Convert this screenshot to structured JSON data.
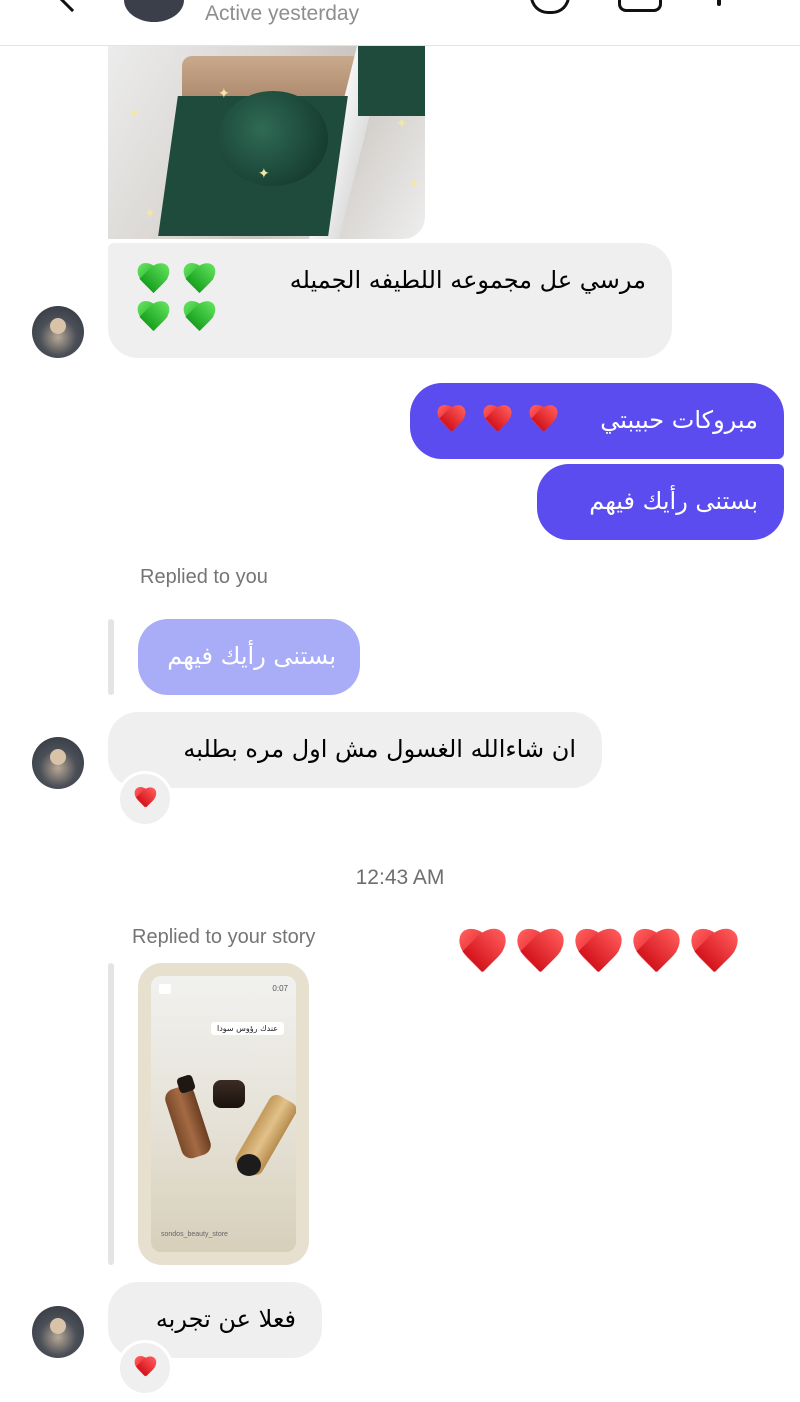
{
  "header": {
    "status": "Active yesterday"
  },
  "messages": {
    "m1": "مرسي عل مجموعه اللطيفه الجميله",
    "m2": "مبروكات حبيبتي",
    "m3": "بستنى رأيك فيهم",
    "reply1_label": "Replied to you",
    "reply1_quote": "بستنى رأيك فيهم",
    "m4": "ان شاءالله الغسول مش اول مره بطلبه",
    "timestamp": "12:43 AM",
    "story_label": "Replied to your story",
    "m5": "فعلا عن تجربه"
  },
  "story": {
    "time": "0:07",
    "caption": "عندك رؤوس سودا",
    "username": "sondos_beauty_store"
  },
  "colors": {
    "outgoing_bubble": "#5b4cf0",
    "incoming_bubble": "#efefef",
    "quoted_bubble": "#a9acf6"
  },
  "icons": [
    "back-chevron-icon",
    "phone-icon",
    "video-icon",
    "info-icon",
    "heart-emoji-icon",
    "green-heart-emoji-icon"
  ]
}
